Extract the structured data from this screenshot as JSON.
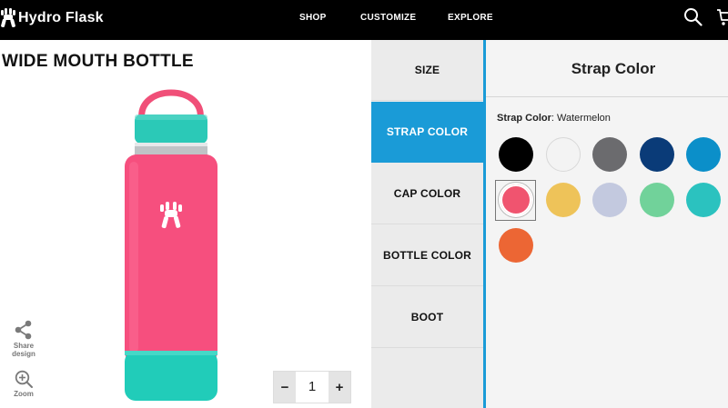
{
  "header": {
    "brand": "Hydro Flask",
    "nav": [
      {
        "label": "SHOP"
      },
      {
        "label": "CUSTOMIZE"
      },
      {
        "label": "EXPLORE"
      }
    ],
    "icons": [
      "search-icon",
      "cart-icon"
    ]
  },
  "product": {
    "title": "WIDE MOUTH BOTTLE",
    "colors": {
      "strap": "#f04f78",
      "cap": "#2bc9b7",
      "bottle": "#f64f7e",
      "boot": "#21ccb9",
      "logo": "#ffffff"
    }
  },
  "tools": {
    "share_label": "Share design",
    "zoom_label": "Zoom"
  },
  "quantity": {
    "minus": "−",
    "value": "1",
    "plus": "+"
  },
  "tabs": [
    {
      "label": "SIZE",
      "active": false
    },
    {
      "label": "STRAP COLOR",
      "active": true
    },
    {
      "label": "CAP COLOR",
      "active": false
    },
    {
      "label": "BOTTLE COLOR",
      "active": false
    },
    {
      "label": "BOOT",
      "active": false
    }
  ],
  "panel": {
    "title": "Strap Color",
    "selected_label": "Strap Color",
    "selected_value": "Watermelon",
    "swatches": [
      {
        "color": "#000000",
        "selected": false
      },
      {
        "color": "#f3f3f3",
        "selected": false
      },
      {
        "color": "#6b6b6e",
        "selected": false
      },
      {
        "color": "#0a3b78",
        "selected": false
      },
      {
        "color": "#0b8fc9",
        "selected": false
      },
      {
        "color": "#f0546f",
        "selected": true
      },
      {
        "color": "#eec359",
        "selected": false
      },
      {
        "color": "#c3c9df",
        "selected": false
      },
      {
        "color": "#71d29a",
        "selected": false
      },
      {
        "color": "#2bc2bf",
        "selected": false
      },
      {
        "color": "#ec6634",
        "selected": false
      }
    ]
  }
}
